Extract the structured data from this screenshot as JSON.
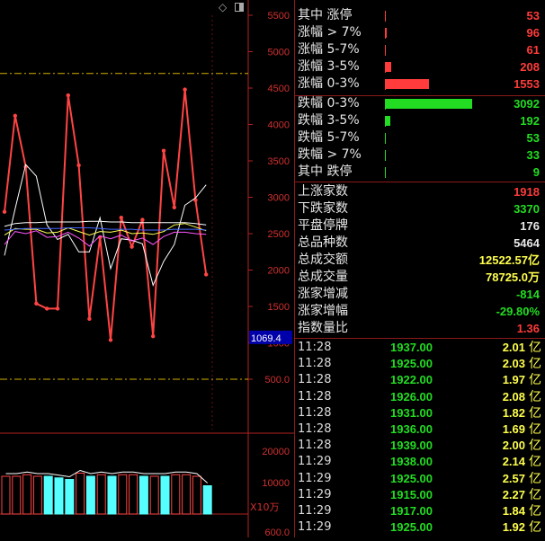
{
  "top_icons": {
    "diamond": "◇",
    "toggle": "▯"
  },
  "y_axis_labels": [
    "5500",
    "5000",
    "4500",
    "4000",
    "3500",
    "3000",
    "2500",
    "2000",
    "1500",
    "1000",
    "500.0"
  ],
  "cursor_value": "1069.4",
  "volume_axis_labels": [
    "20000",
    "10000"
  ],
  "volume_unit": "X10万",
  "volume_bottom_label": "600.0",
  "chart_data": {
    "type": "line",
    "y_range": [
      450,
      5500
    ],
    "series": [
      {
        "values": [
          2800,
          4120,
          3420,
          1540,
          1470,
          1470,
          4400,
          3440,
          1330,
          2450,
          1040,
          2720,
          2320,
          2690,
          1090,
          3640,
          2860,
          4480,
          2960,
          1940
        ]
      },
      {
        "values": [
          2200,
          2840,
          3450,
          3290,
          2620,
          2420,
          2490,
          2250,
          2250,
          2720,
          2020,
          2430,
          2410,
          2360,
          1790,
          2120,
          2350,
          2890,
          2990,
          3170
        ]
      },
      {
        "values": [
          2350,
          2530,
          2500,
          2540,
          2450,
          2460,
          2520,
          2440,
          2330,
          2470,
          2430,
          2480,
          2400,
          2440,
          2350,
          2460,
          2520,
          2520,
          2500,
          2490
        ]
      },
      {
        "values": [
          2480,
          2570,
          2560,
          2560,
          2510,
          2520,
          2580,
          2530,
          2480,
          2530,
          2520,
          2550,
          2500,
          2510,
          2490,
          2530,
          2620,
          2640,
          2590,
          2540
        ]
      },
      {
        "values": [
          2600,
          2640,
          2650,
          2650,
          2660,
          2660,
          2660,
          2660,
          2670,
          2670,
          2660,
          2660,
          2650,
          2650,
          2650,
          2650,
          2650,
          2650,
          2640,
          2620
        ]
      },
      {
        "values": [
          2550,
          2560,
          2570,
          2570,
          2570,
          2570,
          2580,
          2580,
          2580,
          2570,
          2560,
          2560,
          2560,
          2550,
          2550,
          2550,
          2560,
          2560,
          2560,
          2550
        ]
      }
    ],
    "volume_values": [
      12000,
      12000,
      12500,
      12000,
      12000,
      11500,
      11000,
      13000,
      12000,
      12500,
      12000,
      12500,
      12500,
      12000,
      12000,
      12000,
      12500,
      12500,
      12000,
      9000
    ],
    "volume_colors": [
      "red",
      "red",
      "red",
      "red",
      "cyan",
      "cyan",
      "cyan",
      "red",
      "cyan",
      "red",
      "cyan",
      "red",
      "red",
      "cyan",
      "red",
      "cyan",
      "red",
      "red",
      "red",
      "cyan"
    ]
  },
  "stats_up": [
    {
      "label": "其中 涨停",
      "value": "53",
      "bar": 0.01
    },
    {
      "label": "涨幅 > 7%",
      "value": "96",
      "bar": 0.02
    },
    {
      "label": "涨幅 5-7%",
      "value": "61",
      "bar": 0.01
    },
    {
      "label": "涨幅 3-5%",
      "value": "208",
      "bar": 0.07
    },
    {
      "label": "涨幅 0-3%",
      "value": "1553",
      "bar": 0.5
    }
  ],
  "stats_down": [
    {
      "label": "跌幅 0-3%",
      "value": "3092",
      "bar": 1.0
    },
    {
      "label": "跌幅 3-5%",
      "value": "192",
      "bar": 0.06
    },
    {
      "label": "跌幅 5-7%",
      "value": "53",
      "bar": 0.01
    },
    {
      "label": "跌幅 > 7%",
      "value": "33",
      "bar": 0.01
    },
    {
      "label": "其中 跌停",
      "value": "9",
      "bar": 0.005
    }
  ],
  "summary": [
    {
      "label": "上涨家数",
      "value": "1918",
      "color": "red"
    },
    {
      "label": "下跌家数",
      "value": "3370",
      "color": "green"
    },
    {
      "label": "平盘停牌",
      "value": "176",
      "color": "white"
    },
    {
      "label": "总品种数",
      "value": "5464",
      "color": "white"
    },
    {
      "label": "总成交额",
      "value": "12522.57亿",
      "color": "yellow"
    },
    {
      "label": "总成交量",
      "value": "78725.0万",
      "color": "yellow"
    },
    {
      "label": "涨家增减",
      "value": "-814",
      "color": "green"
    },
    {
      "label": "涨家增幅",
      "value": "-29.80%",
      "color": "green"
    },
    {
      "label": "指数量比",
      "value": "1.36",
      "color": "red"
    }
  ],
  "trades": [
    {
      "time": "11:28",
      "price": "1937.00",
      "vol": "2.01",
      "unit": "亿"
    },
    {
      "time": "11:28",
      "price": "1925.00",
      "vol": "2.03",
      "unit": "亿"
    },
    {
      "time": "11:28",
      "price": "1922.00",
      "vol": "1.97",
      "unit": "亿"
    },
    {
      "time": "11:28",
      "price": "1926.00",
      "vol": "2.08",
      "unit": "亿"
    },
    {
      "time": "11:28",
      "price": "1931.00",
      "vol": "1.82",
      "unit": "亿"
    },
    {
      "time": "11:28",
      "price": "1936.00",
      "vol": "1.69",
      "unit": "亿"
    },
    {
      "time": "11:28",
      "price": "1939.00",
      "vol": "2.00",
      "unit": "亿"
    },
    {
      "time": "11:29",
      "price": "1938.00",
      "vol": "2.14",
      "unit": "亿"
    },
    {
      "time": "11:29",
      "price": "1925.00",
      "vol": "2.57",
      "unit": "亿"
    },
    {
      "time": "11:29",
      "price": "1915.00",
      "vol": "2.27",
      "unit": "亿"
    },
    {
      "time": "11:29",
      "price": "1917.00",
      "vol": "1.84",
      "unit": "亿"
    },
    {
      "time": "11:29",
      "price": "1925.00",
      "vol": "1.92",
      "unit": "亿"
    }
  ]
}
